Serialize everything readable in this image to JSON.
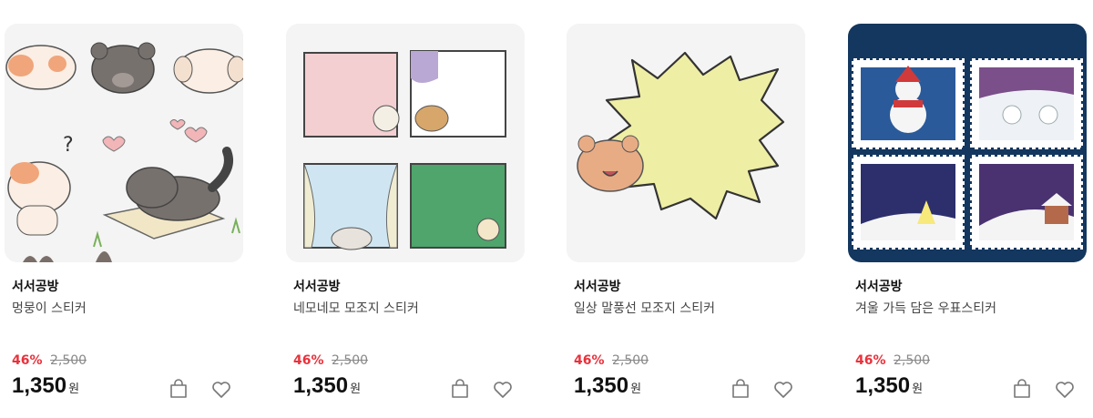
{
  "products": [
    {
      "shop": "서서공방",
      "title": "멍뭉이 스티커",
      "discount": "46%",
      "original_price": "2,500",
      "price": "1,350",
      "unit": "원"
    },
    {
      "shop": "서서공방",
      "title": "네모네모 모조지 스티커",
      "discount": "46%",
      "original_price": "2,500",
      "price": "1,350",
      "unit": "원"
    },
    {
      "shop": "서서공방",
      "title": "일상 말풍선 모조지 스티커",
      "discount": "46%",
      "original_price": "2,500",
      "price": "1,350",
      "unit": "원"
    },
    {
      "shop": "서서공방",
      "title": "겨울 가득 담은 우표스티커",
      "discount": "46%",
      "original_price": "2,500",
      "price": "1,350",
      "unit": "원"
    }
  ],
  "icons": {
    "cart": "shopping-bag-icon",
    "wishlist": "heart-icon"
  },
  "colors": {
    "discount": "#e8323c",
    "stamp_bg": "#13375e"
  }
}
